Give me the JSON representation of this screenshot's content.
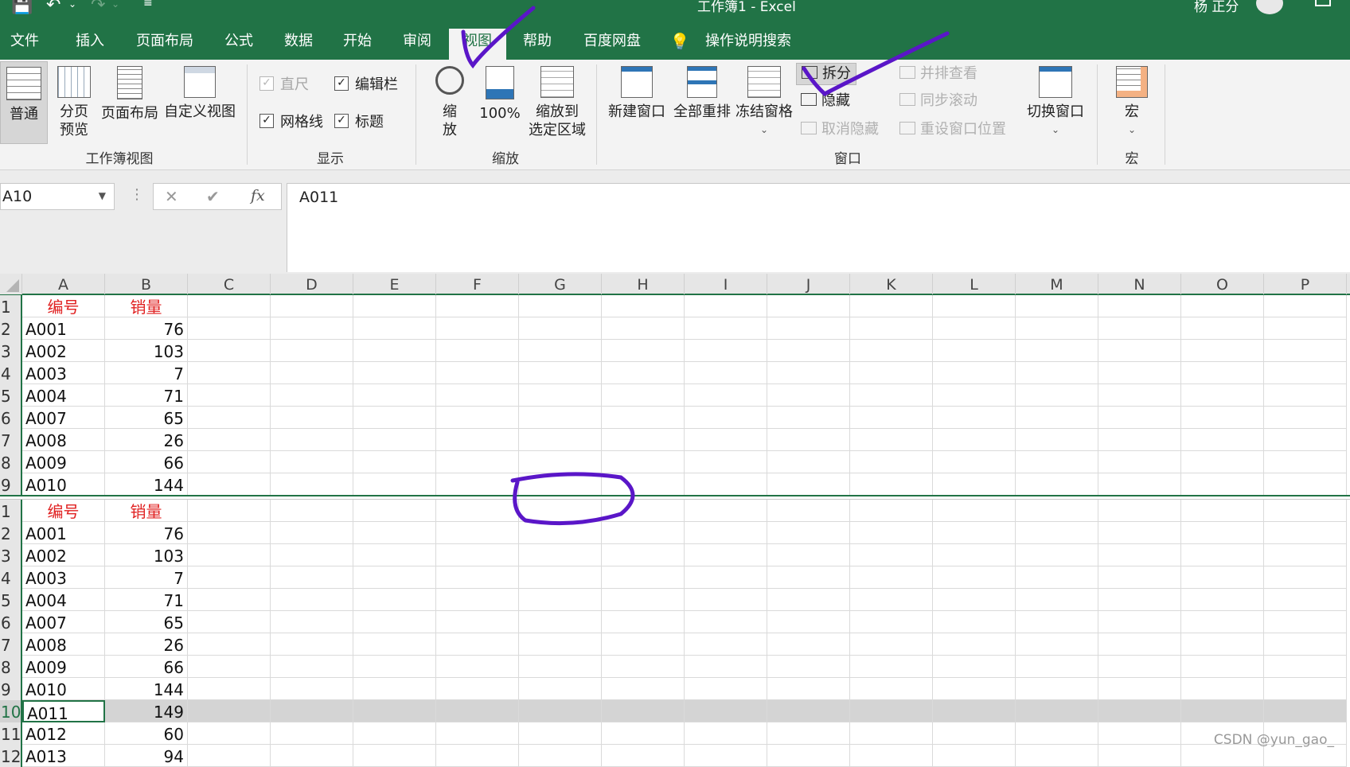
{
  "title_bar": {
    "app_title": "工作簿1  -  Excel",
    "user_name": "杨 正分"
  },
  "tabs": [
    {
      "label": "文件"
    },
    {
      "label": "插入"
    },
    {
      "label": "页面布局"
    },
    {
      "label": "公式"
    },
    {
      "label": "数据"
    },
    {
      "label": "开始"
    },
    {
      "label": "审阅"
    },
    {
      "label": "视图",
      "active": true
    },
    {
      "label": "帮助"
    },
    {
      "label": "百度网盘"
    }
  ],
  "tell_me": "操作说明搜索",
  "ribbon": {
    "workbook_views": {
      "label": "工作簿视图",
      "normal": "普通",
      "page_break_1": "分页",
      "page_break_2": "预览",
      "page_layout": "页面布局",
      "custom_views": "自定义视图"
    },
    "show": {
      "label": "显示",
      "ruler": "直尺",
      "formula_bar": "编辑栏",
      "gridlines": "网格线",
      "headings": "标题"
    },
    "zoom": {
      "label": "缩放",
      "zoom_1": "缩",
      "zoom_2": "放",
      "hundred": "100%",
      "zoom_sel_1": "缩放到",
      "zoom_sel_2": "选定区域"
    },
    "window": {
      "label": "窗口",
      "new_window": "新建窗口",
      "arrange_all": "全部重排",
      "freeze_panes": "冻结窗格",
      "split": "拆分",
      "hide": "隐藏",
      "unhide": "取消隐藏",
      "side_by_side": "并排查看",
      "sync_scroll": "同步滚动",
      "reset_pos": "重设窗口位置",
      "switch": "切换窗口"
    },
    "macros": {
      "label": "宏",
      "macros": "宏"
    }
  },
  "formula_bar": {
    "name_box": "A10",
    "cancel": "✕",
    "enter": "✔",
    "fx": "fx",
    "value": "A011"
  },
  "columns": [
    "A",
    "B",
    "C",
    "D",
    "E",
    "F",
    "G",
    "H",
    "I",
    "J",
    "K",
    "L",
    "M",
    "N",
    "O",
    "P"
  ],
  "top_pane": {
    "rows": [
      {
        "n": "1",
        "a": "编号",
        "b": "销量",
        "header": true
      },
      {
        "n": "2",
        "a": "A001",
        "b": "76"
      },
      {
        "n": "3",
        "a": "A002",
        "b": "103"
      },
      {
        "n": "4",
        "a": "A003",
        "b": "7"
      },
      {
        "n": "5",
        "a": "A004",
        "b": "71"
      },
      {
        "n": "6",
        "a": "A007",
        "b": "65"
      },
      {
        "n": "7",
        "a": "A008",
        "b": "26"
      },
      {
        "n": "8",
        "a": "A009",
        "b": "66"
      },
      {
        "n": "9",
        "a": "A010",
        "b": "144"
      }
    ]
  },
  "bottom_pane": {
    "rows": [
      {
        "n": "1",
        "a": "编号",
        "b": "销量",
        "header": true
      },
      {
        "n": "2",
        "a": "A001",
        "b": "76"
      },
      {
        "n": "3",
        "a": "A002",
        "b": "103"
      },
      {
        "n": "4",
        "a": "A003",
        "b": "7"
      },
      {
        "n": "5",
        "a": "A004",
        "b": "71"
      },
      {
        "n": "6",
        "a": "A007",
        "b": "65"
      },
      {
        "n": "7",
        "a": "A008",
        "b": "26"
      },
      {
        "n": "8",
        "a": "A009",
        "b": "66"
      },
      {
        "n": "9",
        "a": "A010",
        "b": "144"
      },
      {
        "n": "10",
        "a": "A011",
        "b": "149",
        "selected": true
      },
      {
        "n": "11",
        "a": "A012",
        "b": "60"
      },
      {
        "n": "12",
        "a": "A013",
        "b": "94"
      }
    ]
  },
  "watermark": "CSDN @yun_gao_",
  "colors": {
    "excel_green": "#217346",
    "header_red": "#e02020",
    "annotation_purple": "#5a16c8"
  }
}
